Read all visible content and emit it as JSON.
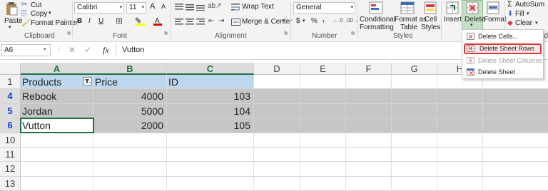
{
  "ribbon": {
    "clipboard": {
      "paste": "Paste",
      "cut": "Cut",
      "copy": "Copy",
      "copy_caret": "▾",
      "format_painter": "Format Painter",
      "group": "Clipboard"
    },
    "font": {
      "name": "Calibri",
      "size": "11",
      "grow": "A",
      "shrink": "A",
      "bold": "B",
      "italic": "I",
      "underline": "U",
      "group": "Font"
    },
    "alignment": {
      "wrap": "Wrap Text",
      "merge": "Merge & Center",
      "group": "Alignment"
    },
    "number": {
      "format": "General",
      "currency": "$",
      "percent": "%",
      "comma": ",",
      "group": "Number"
    },
    "styles": {
      "conditional_1": "Conditional",
      "conditional_2": "Formatting",
      "format_as_1": "Format as",
      "format_as_2": "Table",
      "cell_1": "Cell",
      "cell_2": "Styles",
      "group": "Styles"
    },
    "cells": {
      "insert": "Insert",
      "delete": "Delete",
      "format": "Format"
    },
    "editing": {
      "autosum": "AutoSum",
      "fill": "Fill",
      "clear": "Clear",
      "group": "Edit"
    }
  },
  "formula_bar": {
    "name_box": "A6",
    "fx": "fx",
    "value": "Vutton"
  },
  "sheet": {
    "columns": [
      "A",
      "B",
      "C",
      "D",
      "E",
      "F",
      "G",
      "H"
    ],
    "rows": [
      {
        "num": "1",
        "cells": [
          "Products",
          "Price",
          "ID"
        ]
      },
      {
        "num": "4",
        "cells": [
          "Rebook",
          "4000",
          "103"
        ]
      },
      {
        "num": "5",
        "cells": [
          "Jordan",
          "5000",
          "104"
        ]
      },
      {
        "num": "6",
        "cells": [
          "Vutton",
          "2000",
          "105"
        ]
      },
      {
        "num": "10",
        "cells": [
          "",
          "",
          ""
        ]
      },
      {
        "num": "11",
        "cells": [
          "",
          "",
          ""
        ]
      },
      {
        "num": "12",
        "cells": [
          "",
          "",
          ""
        ]
      },
      {
        "num": "13",
        "cells": [
          "",
          "",
          ""
        ]
      }
    ]
  },
  "delete_menu": {
    "items": [
      {
        "label": "Delete Cells...",
        "enabled": true
      },
      {
        "label": "Delete Sheet Rows",
        "enabled": true,
        "highlighted": true
      },
      {
        "label": "Delete Sheet Columns",
        "enabled": false
      },
      {
        "label": "Delete Sheet",
        "enabled": true
      }
    ]
  },
  "colors": {
    "header_fill": "#bdd7ee",
    "selected_row_fill": "#c6c6c6",
    "accent": "#217346",
    "highlight_border": "#d9393d"
  }
}
